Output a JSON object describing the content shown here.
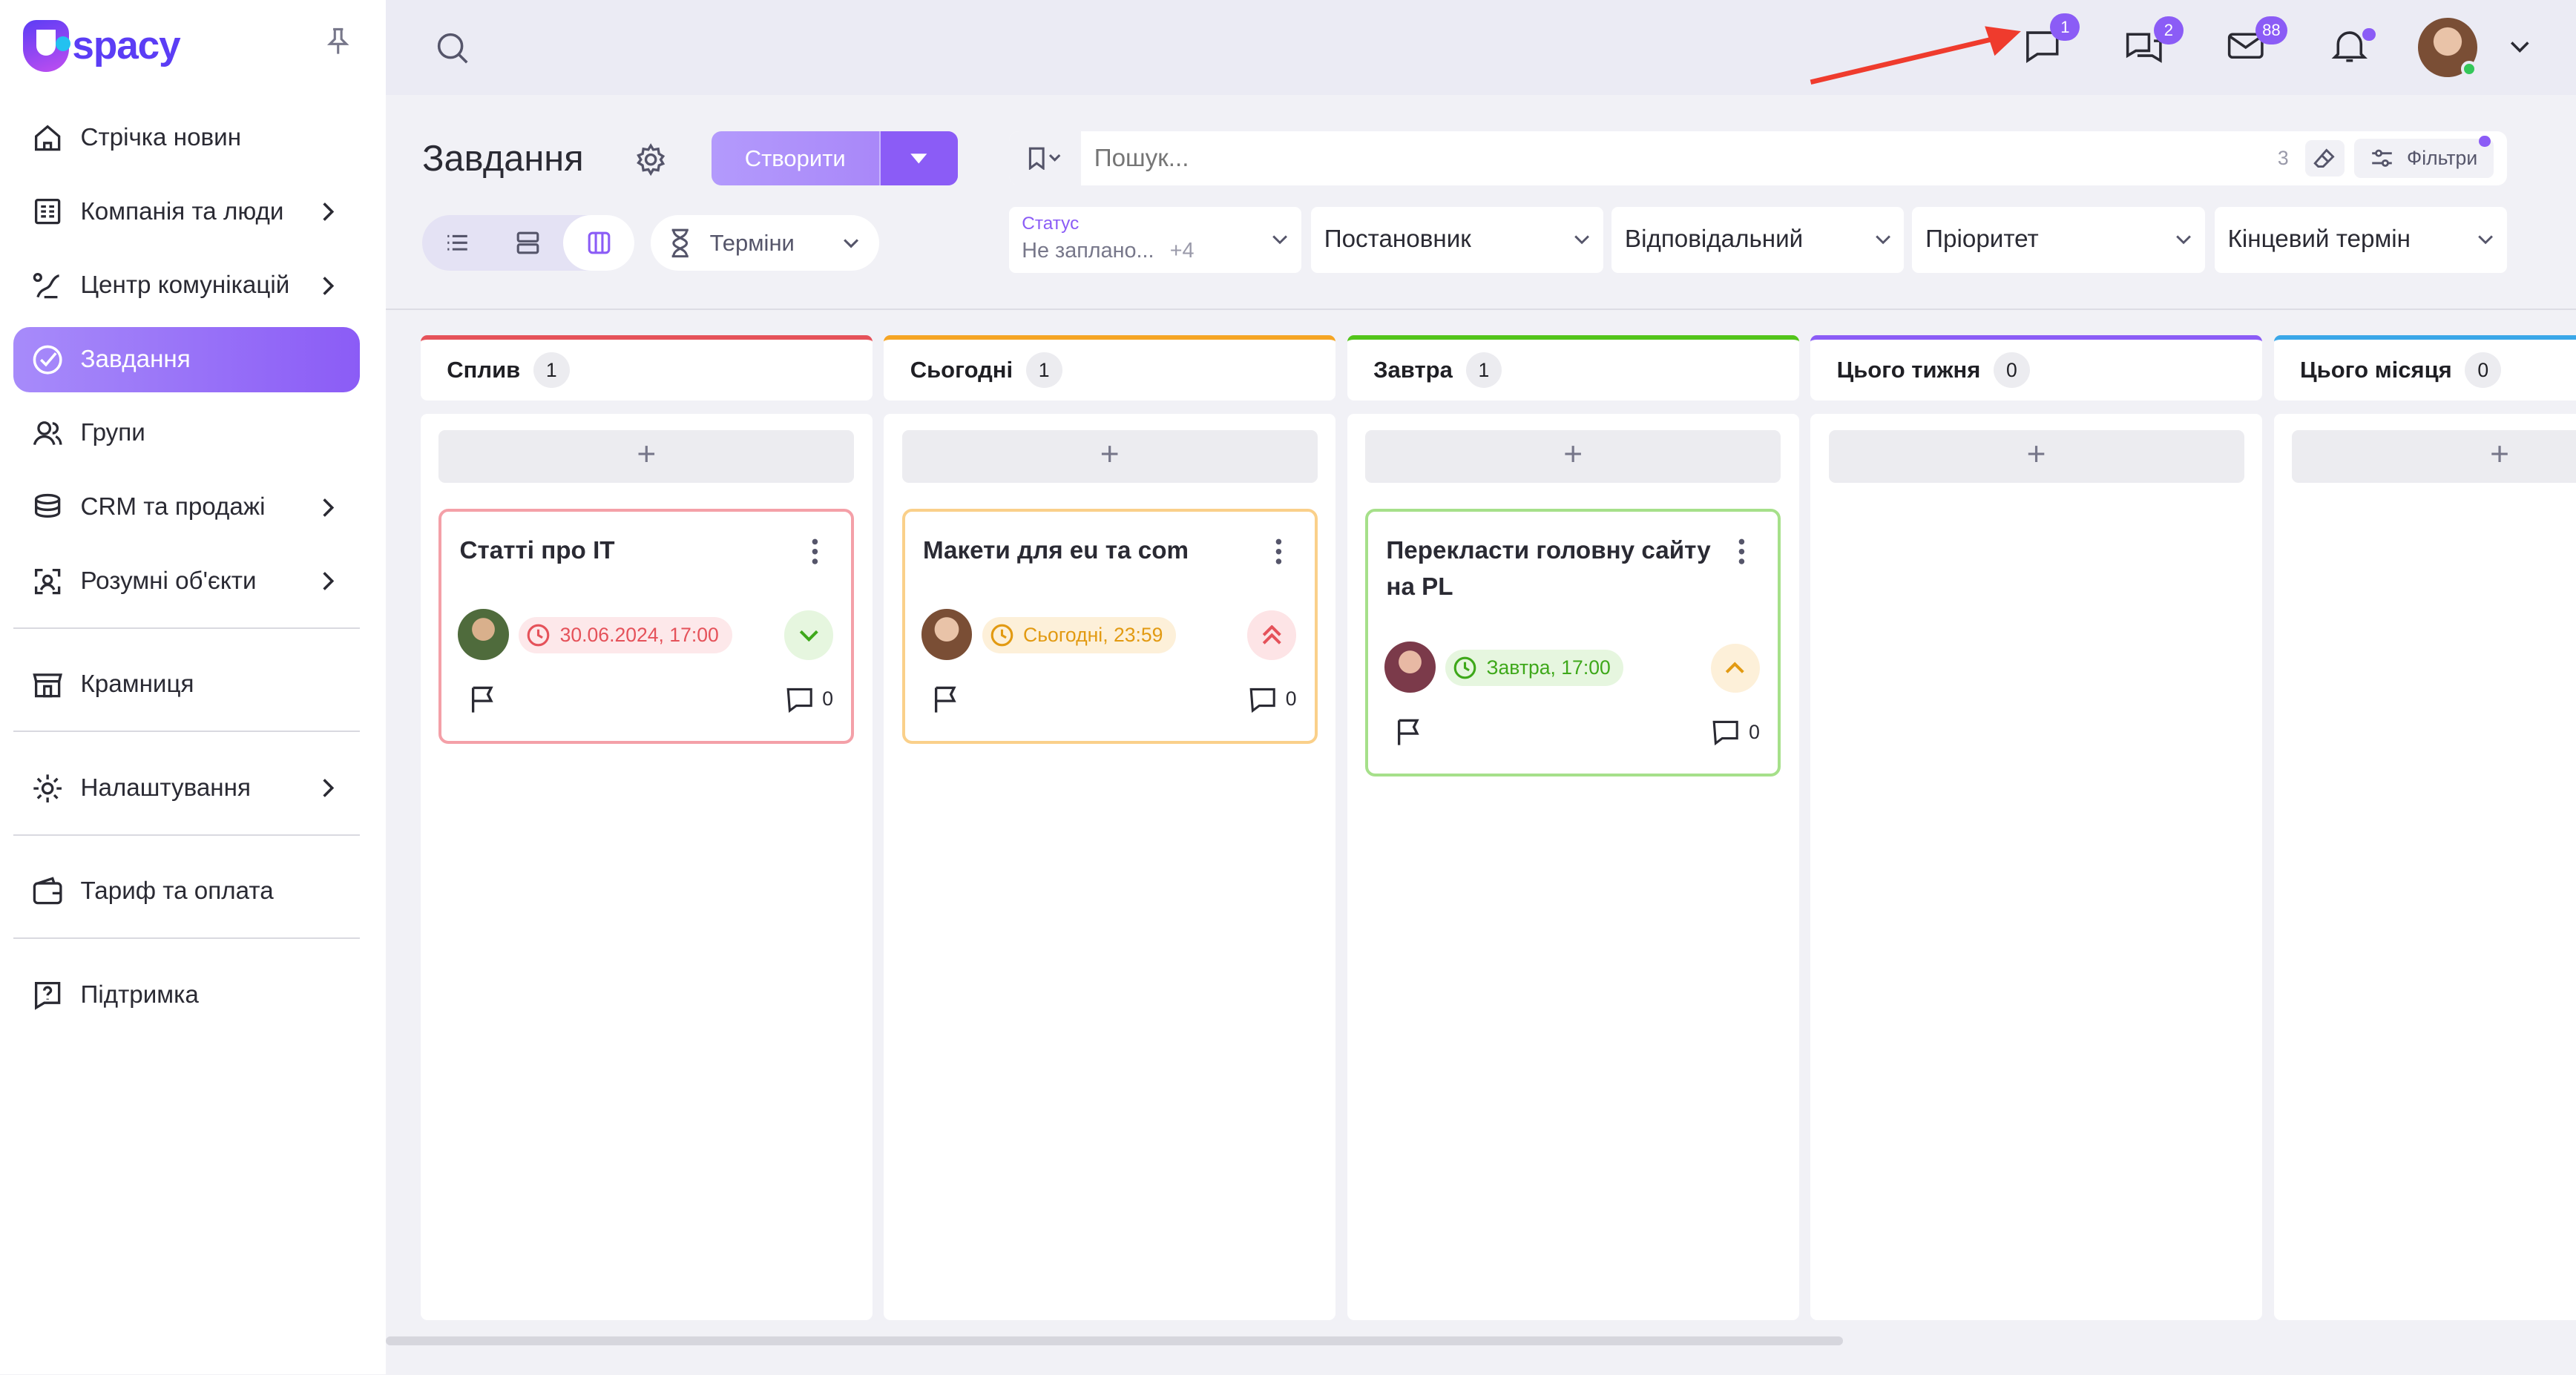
{
  "brand": {
    "logo_text": "spacy"
  },
  "sidebar": {
    "items": [
      {
        "label": "Стрічка новин"
      },
      {
        "label": "Компанія та люди"
      },
      {
        "label": "Центр комунікацій"
      },
      {
        "label": "Завдання"
      },
      {
        "label": "Групи"
      },
      {
        "label": "CRM та продажі"
      },
      {
        "label": "Розумні об'єкти"
      },
      {
        "label": "Крамниця"
      },
      {
        "label": "Налаштування"
      },
      {
        "label": "Тариф та оплата"
      },
      {
        "label": "Підтримка"
      }
    ]
  },
  "topbar": {
    "badges": {
      "chat": "1",
      "messages": "2",
      "mail": "88"
    }
  },
  "page": {
    "title": "Завдання",
    "create_label": "Створити",
    "terms_label": "Терміни"
  },
  "search": {
    "placeholder": "Пошук...",
    "count": "3",
    "filters_label": "Фільтри"
  },
  "filters": {
    "status_label": "Статус",
    "status_value": "Не заплано...",
    "status_more": "+4",
    "setter": "Постановник",
    "responsible": "Відповідальний",
    "priority": "Пріоритет",
    "deadline": "Кінцевий термін"
  },
  "columns": [
    {
      "title": "Сплив",
      "count": "1",
      "color": "#e5525a"
    },
    {
      "title": "Сьогодні",
      "count": "1",
      "color": "#f5a524"
    },
    {
      "title": "Завтра",
      "count": "1",
      "color": "#52c41a"
    },
    {
      "title": "Цього тижня",
      "count": "0",
      "color": "#8b5cf6"
    },
    {
      "title": "Цього місяця",
      "count": "0",
      "color": "#3aa7e8"
    }
  ],
  "cards": [
    {
      "title": "Статті про IT",
      "date": "30.06.2024, 17:00",
      "comments": "0",
      "priority": "low"
    },
    {
      "title": "Макети для eu та com",
      "date": "Сьогодні, 23:59",
      "comments": "0",
      "priority": "highest"
    },
    {
      "title": "Перекласти головну сайту на PL",
      "date": "Завтра, 17:00",
      "comments": "0",
      "priority": "high"
    }
  ],
  "add_symbol": "+"
}
